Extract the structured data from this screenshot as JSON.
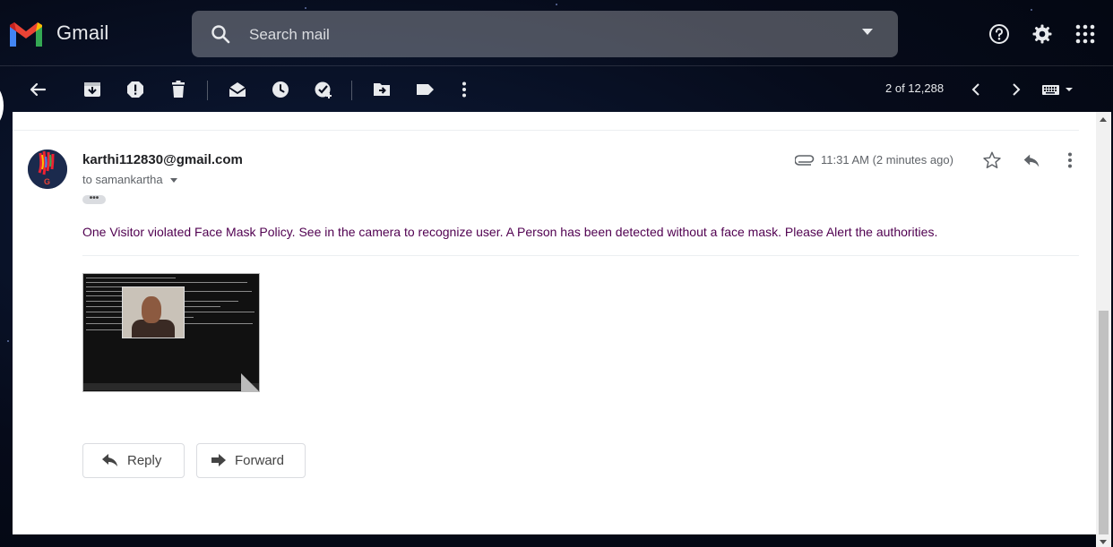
{
  "app": {
    "name": "Gmail",
    "logo_icon": "gmail-logo-icon"
  },
  "search": {
    "placeholder": "Search mail"
  },
  "toolbar": {
    "page_count": "2 of 12,288"
  },
  "message": {
    "sender": "karthi112830@gmail.com",
    "to": "to samankartha",
    "time": "11:31 AM (2 minutes ago)",
    "body": "One Visitor violated Face Mask Policy. See in the camera to recognize user. A Person has been detected without a face mask. Please Alert the authorities.",
    "trimmed_indicator": "•••"
  },
  "actions": {
    "reply_label": "Reply",
    "forward_label": "Forward"
  },
  "colors": {
    "body_text": "#500050",
    "header_bg": "#060b1a"
  }
}
